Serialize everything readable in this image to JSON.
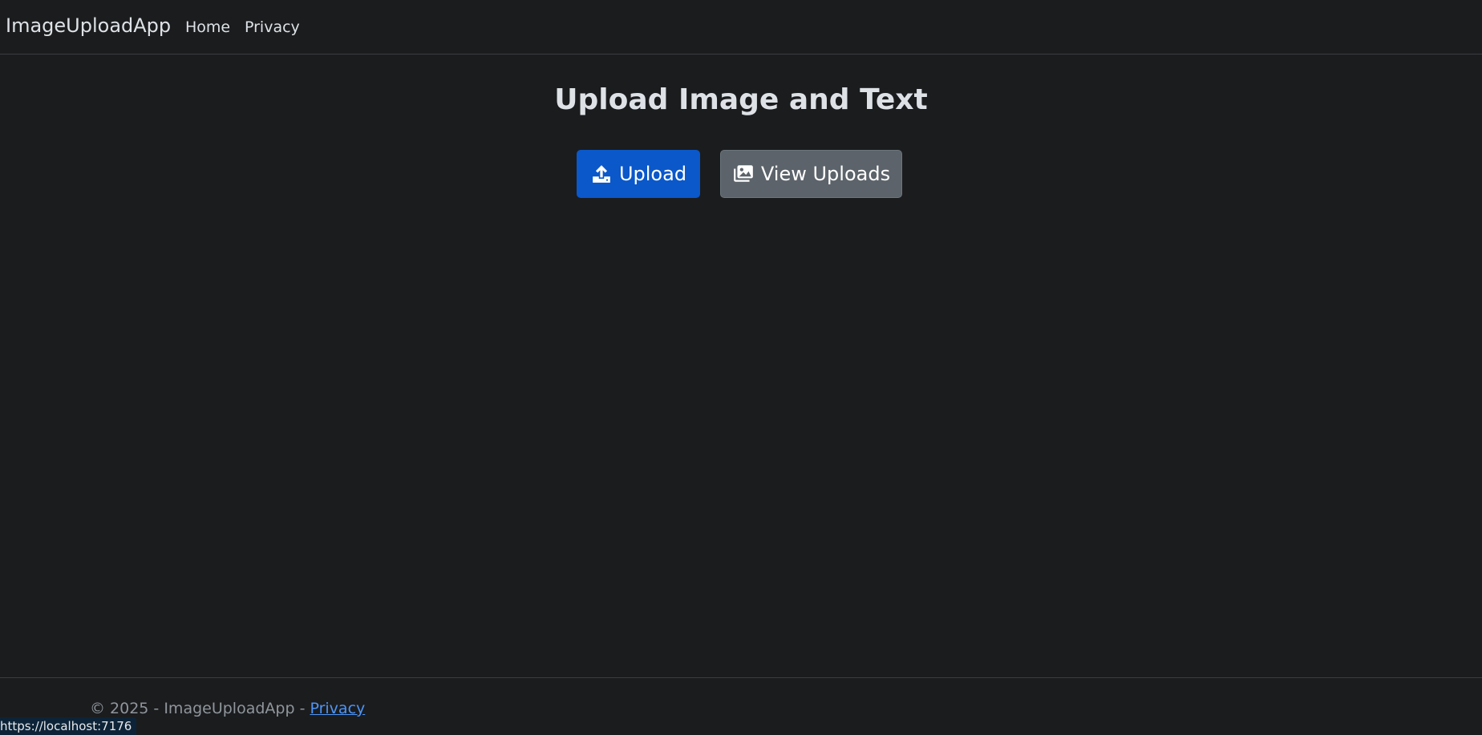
{
  "navbar": {
    "brand": "ImageUploadApp",
    "links": [
      {
        "label": "Home"
      },
      {
        "label": "Privacy"
      }
    ]
  },
  "main": {
    "title": "Upload Image and Text",
    "buttons": {
      "upload_label": "Upload",
      "upload_icon": "upload-icon",
      "view_label": "View Uploads",
      "view_icon": "images-icon"
    }
  },
  "footer": {
    "copyright": "© 2025 - ImageUploadApp - ",
    "privacy_link": "Privacy"
  },
  "status_bar": {
    "url": "https://localhost:7176"
  },
  "colors": {
    "background": "#1b1c1e",
    "primary": "#0a58ca",
    "secondary": "#5c636a",
    "link": "#4d95f7"
  }
}
